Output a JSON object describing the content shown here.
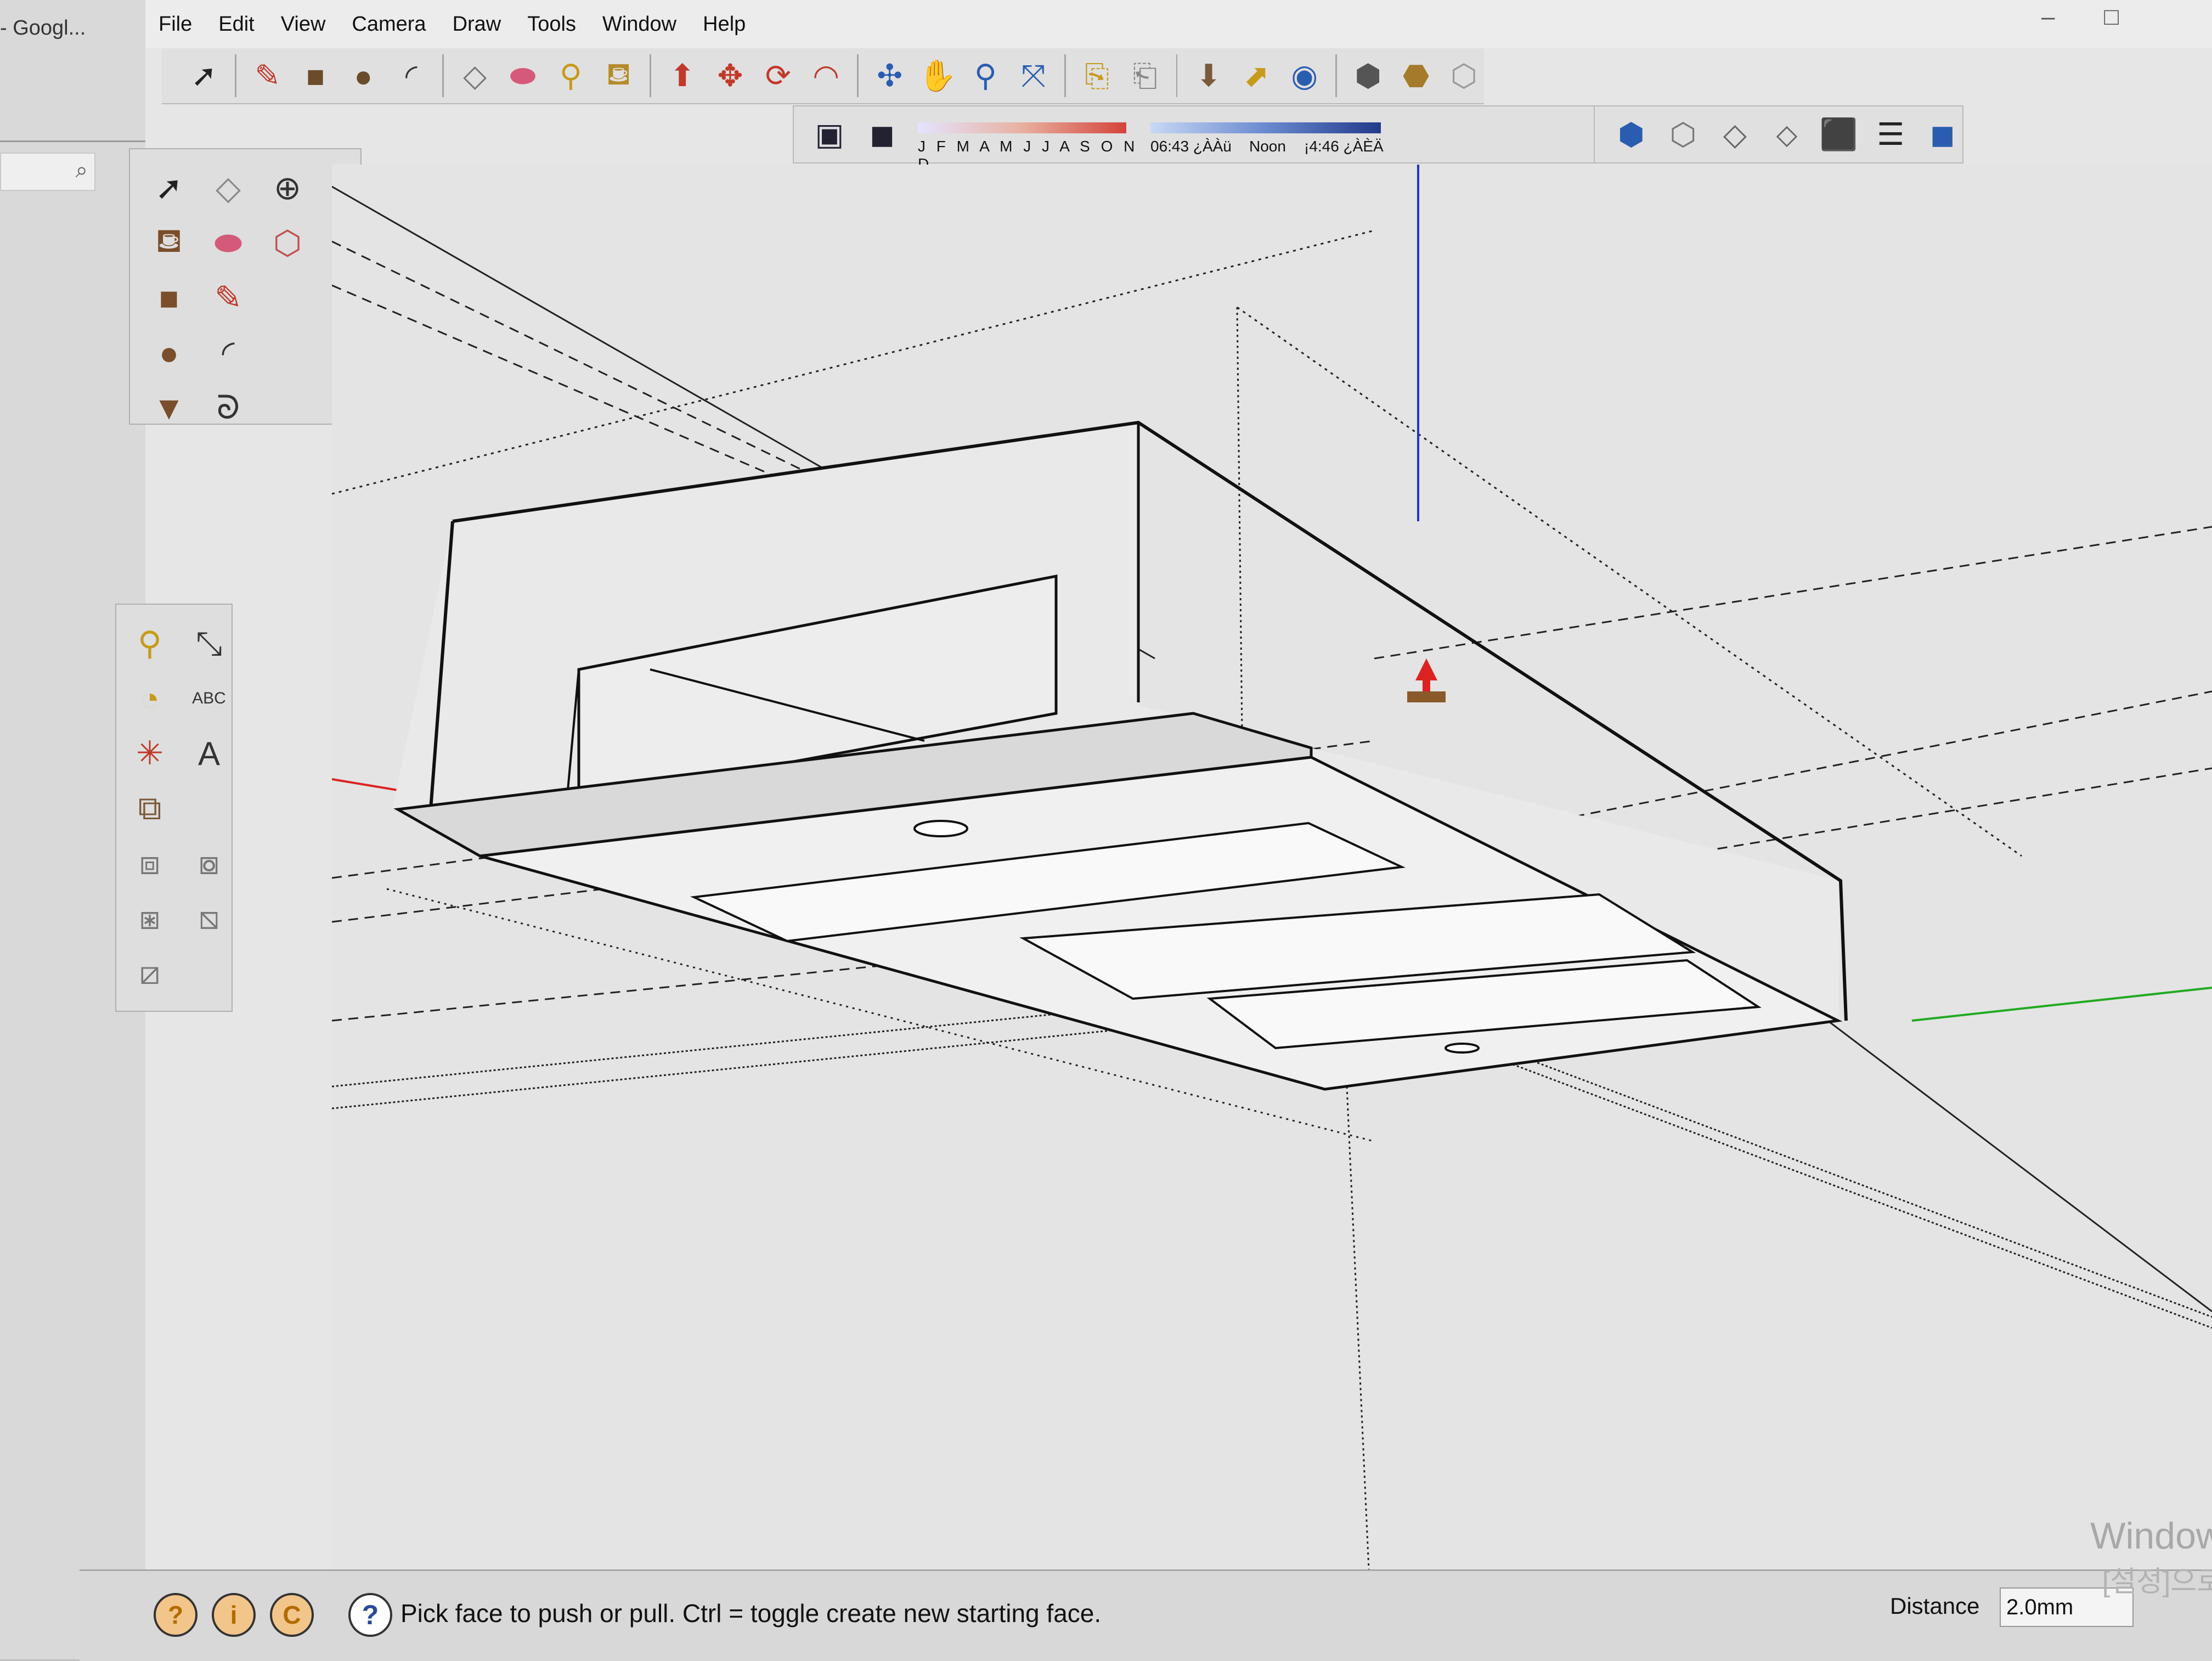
{
  "background_app": {
    "tab_title": "- Googl...",
    "search_icon": "search-icon"
  },
  "menu": {
    "items": [
      "File",
      "Edit",
      "View",
      "Camera",
      "Draw",
      "Tools",
      "Window",
      "Help"
    ]
  },
  "shadow_toolbar": {
    "months": "J F M A M J J A S O N D",
    "time_start": "06:43 ¿ÀÀü",
    "time_noon": "Noon",
    "time_end": "¡4:46 ¿ÀÈÄ"
  },
  "status": {
    "message": "Pick face to push or pull.  Ctrl = toggle create new starting face.",
    "vcb_label": "Distance",
    "vcb_value": "2.0mm"
  },
  "watermark": {
    "line1": "Window",
    "line2": "[설정]으로"
  },
  "colors": {
    "axis_red": "#d22",
    "axis_green": "#2a2",
    "axis_blue": "#22c",
    "viewport_bg": "#e4e4e4"
  }
}
